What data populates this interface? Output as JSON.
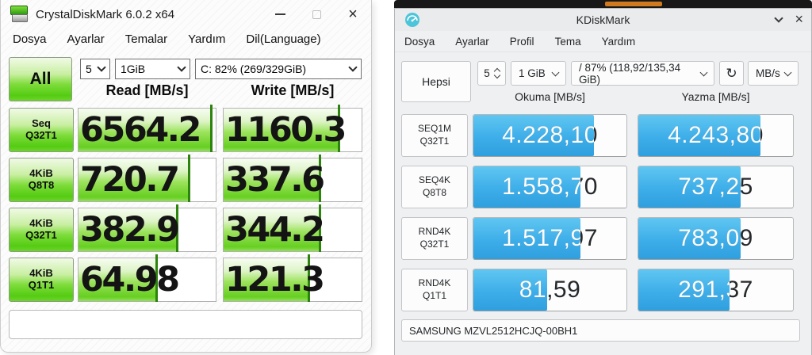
{
  "colors": {
    "cdm_green": "#6fd32a",
    "kdm_blue": "#3daee9",
    "strip_orange": "#cf7a1e",
    "kdm_window_bg": "#eff0f1"
  },
  "cdm": {
    "window_title": "CrystalDiskMark 6.0.2 x64",
    "close_glyph": "×",
    "menu": [
      "Dosya",
      "Ayarlar",
      "Temalar",
      "Yardım",
      "Dil(Language)"
    ],
    "all_button": "All",
    "run_count": "5",
    "test_size": "1GiB",
    "target_drive": "C: 82% (269/329GiB)",
    "read_header": "Read [MB/s]",
    "write_header": "Write [MB/s]",
    "comment_value": "",
    "rows": [
      {
        "label1": "Seq",
        "label2": "Q32T1",
        "read": "6564.2",
        "write": "1160.3",
        "read_fill": 97,
        "write_fill": 84
      },
      {
        "label1": "4KiB",
        "label2": "Q8T8",
        "read": "720.7",
        "write": "337.6",
        "read_fill": 81,
        "write_fill": 70
      },
      {
        "label1": "4KiB",
        "label2": "Q32T1",
        "read": "382.9",
        "write": "344.2",
        "read_fill": 72,
        "write_fill": 70
      },
      {
        "label1": "4KiB",
        "label2": "Q1T1",
        "read": "64.98",
        "write": "121.3",
        "read_fill": 57,
        "write_fill": 62
      }
    ]
  },
  "kdm": {
    "window_title": "KDiskMark",
    "close_glyph": "×",
    "menu": [
      "Dosya",
      "Ayarlar",
      "Profil",
      "Tema",
      "Yardım"
    ],
    "all_button": "Hepsi",
    "run_count": "5",
    "test_size": "1 GiB",
    "target_drive": "/ 87% (118,92/135,34 GiB)",
    "refresh_glyph": "↻",
    "unit": "MB/s",
    "read_header": "Okuma [MB/s]",
    "write_header": "Yazma [MB/s]",
    "device": "SAMSUNG MZVL2512HCJQ-00BH1",
    "rows": [
      {
        "label1": "SEQ1M",
        "label2": "Q32T1",
        "read": "4.228,10",
        "write": "4.243,80",
        "read_fill": 79,
        "write_fill": 79
      },
      {
        "label1": "SEQ4K",
        "label2": "Q8T8",
        "read": "1.558,70",
        "write": "737,25",
        "read_fill": 70,
        "write_fill": 66
      },
      {
        "label1": "RND4K",
        "label2": "Q32T1",
        "read": "1.517,97",
        "write": "783,09",
        "read_fill": 70,
        "write_fill": 66
      },
      {
        "label1": "RND4K",
        "label2": "Q1T1",
        "read": "81,59",
        "write": "291,37",
        "read_fill": 48,
        "write_fill": 59
      }
    ]
  }
}
